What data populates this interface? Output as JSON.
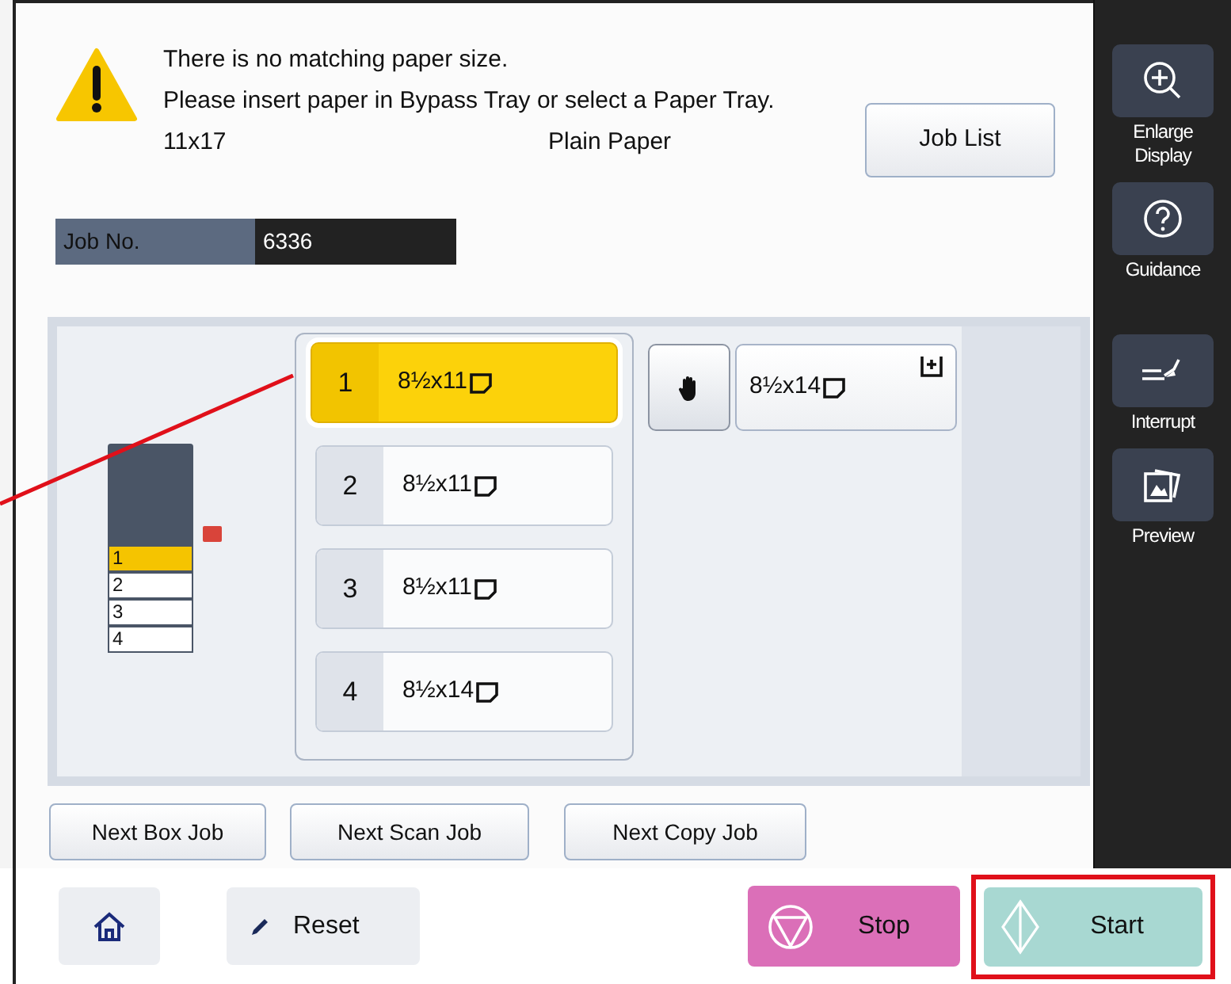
{
  "alert": {
    "lines": [
      "There is no matching paper size.",
      "Please insert paper in Bypass Tray or select a Paper Tray."
    ],
    "paper_size": "11x17",
    "paper_type": "Plain Paper"
  },
  "job_list_button": "Job List",
  "job_no": {
    "label": "Job No.",
    "value": "6336"
  },
  "machine_diagram": {
    "trays": [
      {
        "label": "1",
        "selected": true
      },
      {
        "label": "2",
        "selected": false
      },
      {
        "label": "3",
        "selected": false
      },
      {
        "label": "4",
        "selected": false
      }
    ]
  },
  "trays": [
    {
      "number": "1",
      "size": "8½x11",
      "selected": true
    },
    {
      "number": "2",
      "size": "8½x11",
      "selected": false
    },
    {
      "number": "3",
      "size": "8½x11",
      "selected": false
    },
    {
      "number": "4",
      "size": "8½x14",
      "selected": false
    }
  ],
  "bypass_tray": {
    "size": "8½x14"
  },
  "next_job_buttons": [
    "Next Box Job",
    "Next Scan Job",
    "Next Copy Job"
  ],
  "sidebar": [
    {
      "kind": "enlarge",
      "label": "Enlarge Display"
    },
    {
      "kind": "guidance",
      "label": "Guidance"
    },
    {
      "kind": "interrupt",
      "label": "Interrupt"
    },
    {
      "kind": "preview",
      "label": "Preview"
    }
  ],
  "bottom_bar": {
    "reset": "Reset",
    "stop": "Stop",
    "start": "Start"
  }
}
